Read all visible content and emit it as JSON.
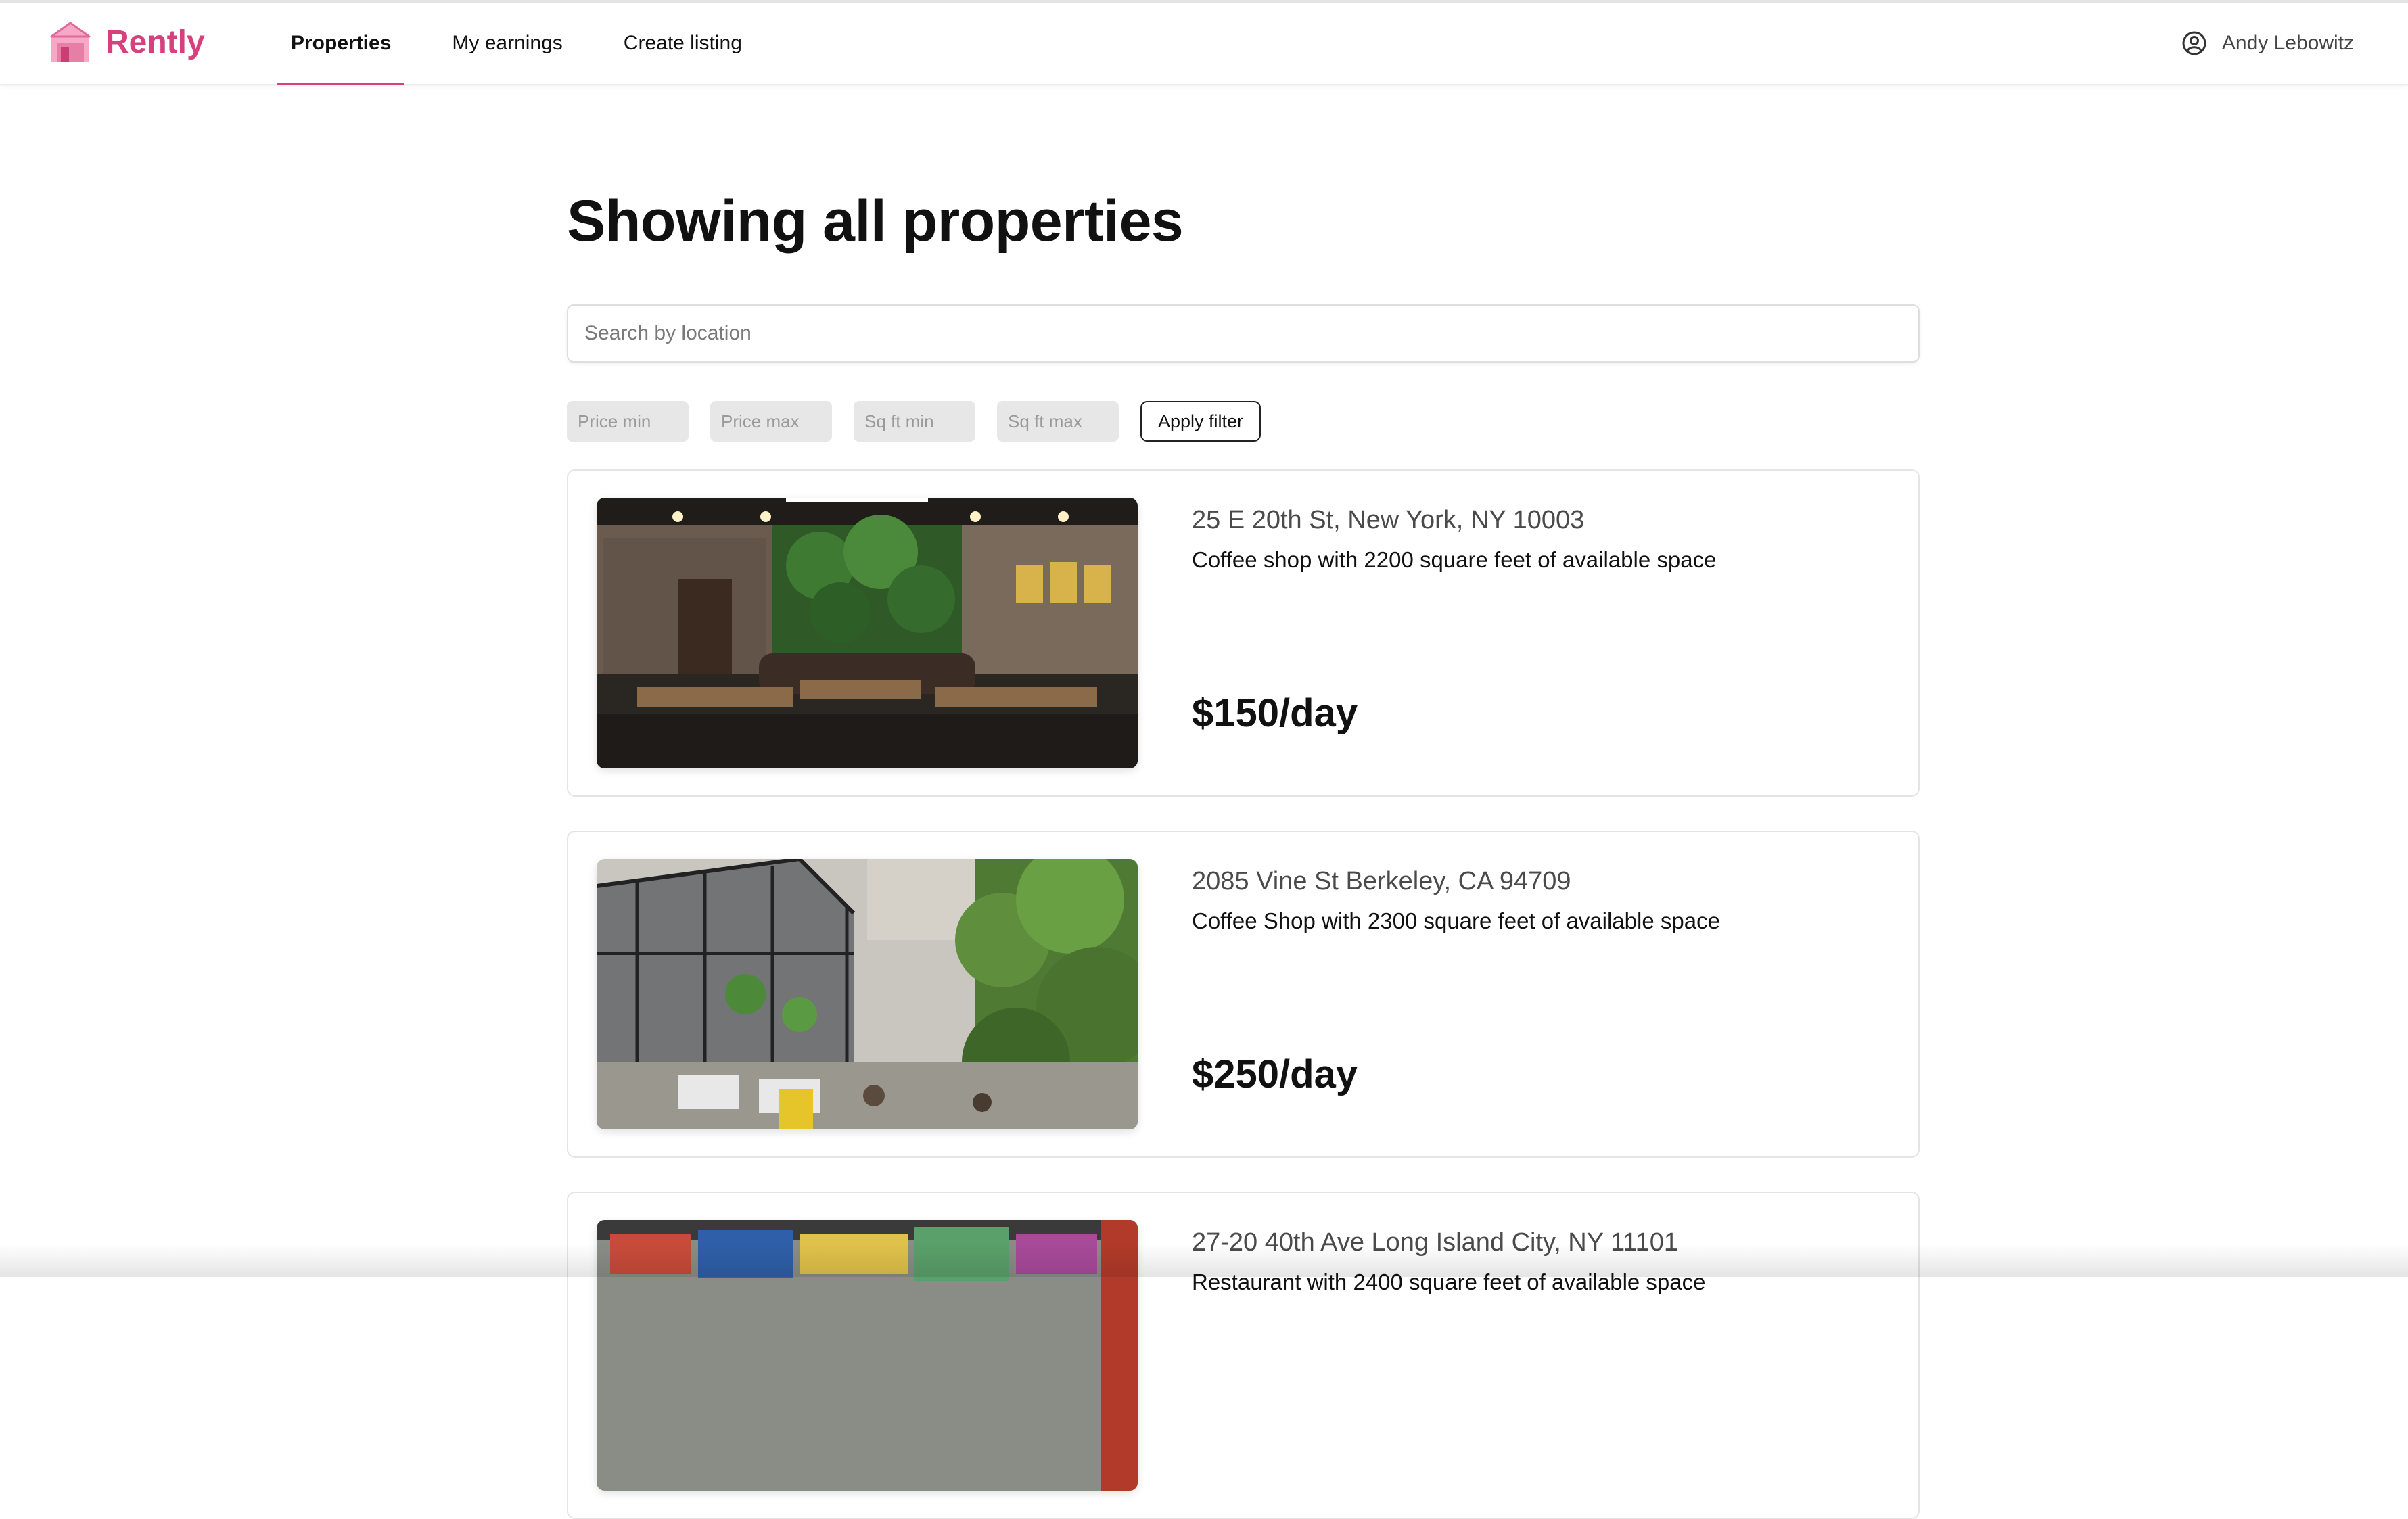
{
  "app": {
    "name": "Rently",
    "brand_color": "#d6417d"
  },
  "nav": {
    "items": [
      {
        "label": "Properties",
        "active": true
      },
      {
        "label": "My earnings",
        "active": false
      },
      {
        "label": "Create listing",
        "active": false
      }
    ],
    "user_name": "Andy Lebowitz"
  },
  "main": {
    "title": "Showing all properties",
    "search": {
      "placeholder": "Search by location",
      "value": ""
    },
    "filters": {
      "price_min_placeholder": "Price min",
      "price_max_placeholder": "Price max",
      "sqft_min_placeholder": "Sq ft min",
      "sqft_max_placeholder": "Sq ft max",
      "apply_label": "Apply filter"
    },
    "listings": [
      {
        "address": "25 E 20th St, New York, NY 10003",
        "description": "Coffee shop with 2200 square feet of available space",
        "price": "$150/day",
        "image": "coffee-shop-interior-photo"
      },
      {
        "address": "2085 Vine St Berkeley, CA 94709",
        "description": "Coffee Shop with 2300 square feet of available space",
        "price": "$250/day",
        "image": "greenhouse-patio-photo"
      },
      {
        "address": "27-20 40th Ave Long Island City, NY 11101",
        "description": "Restaurant with 2400 square feet of available space",
        "price": "",
        "image": "graffiti-wall-photo"
      }
    ]
  }
}
